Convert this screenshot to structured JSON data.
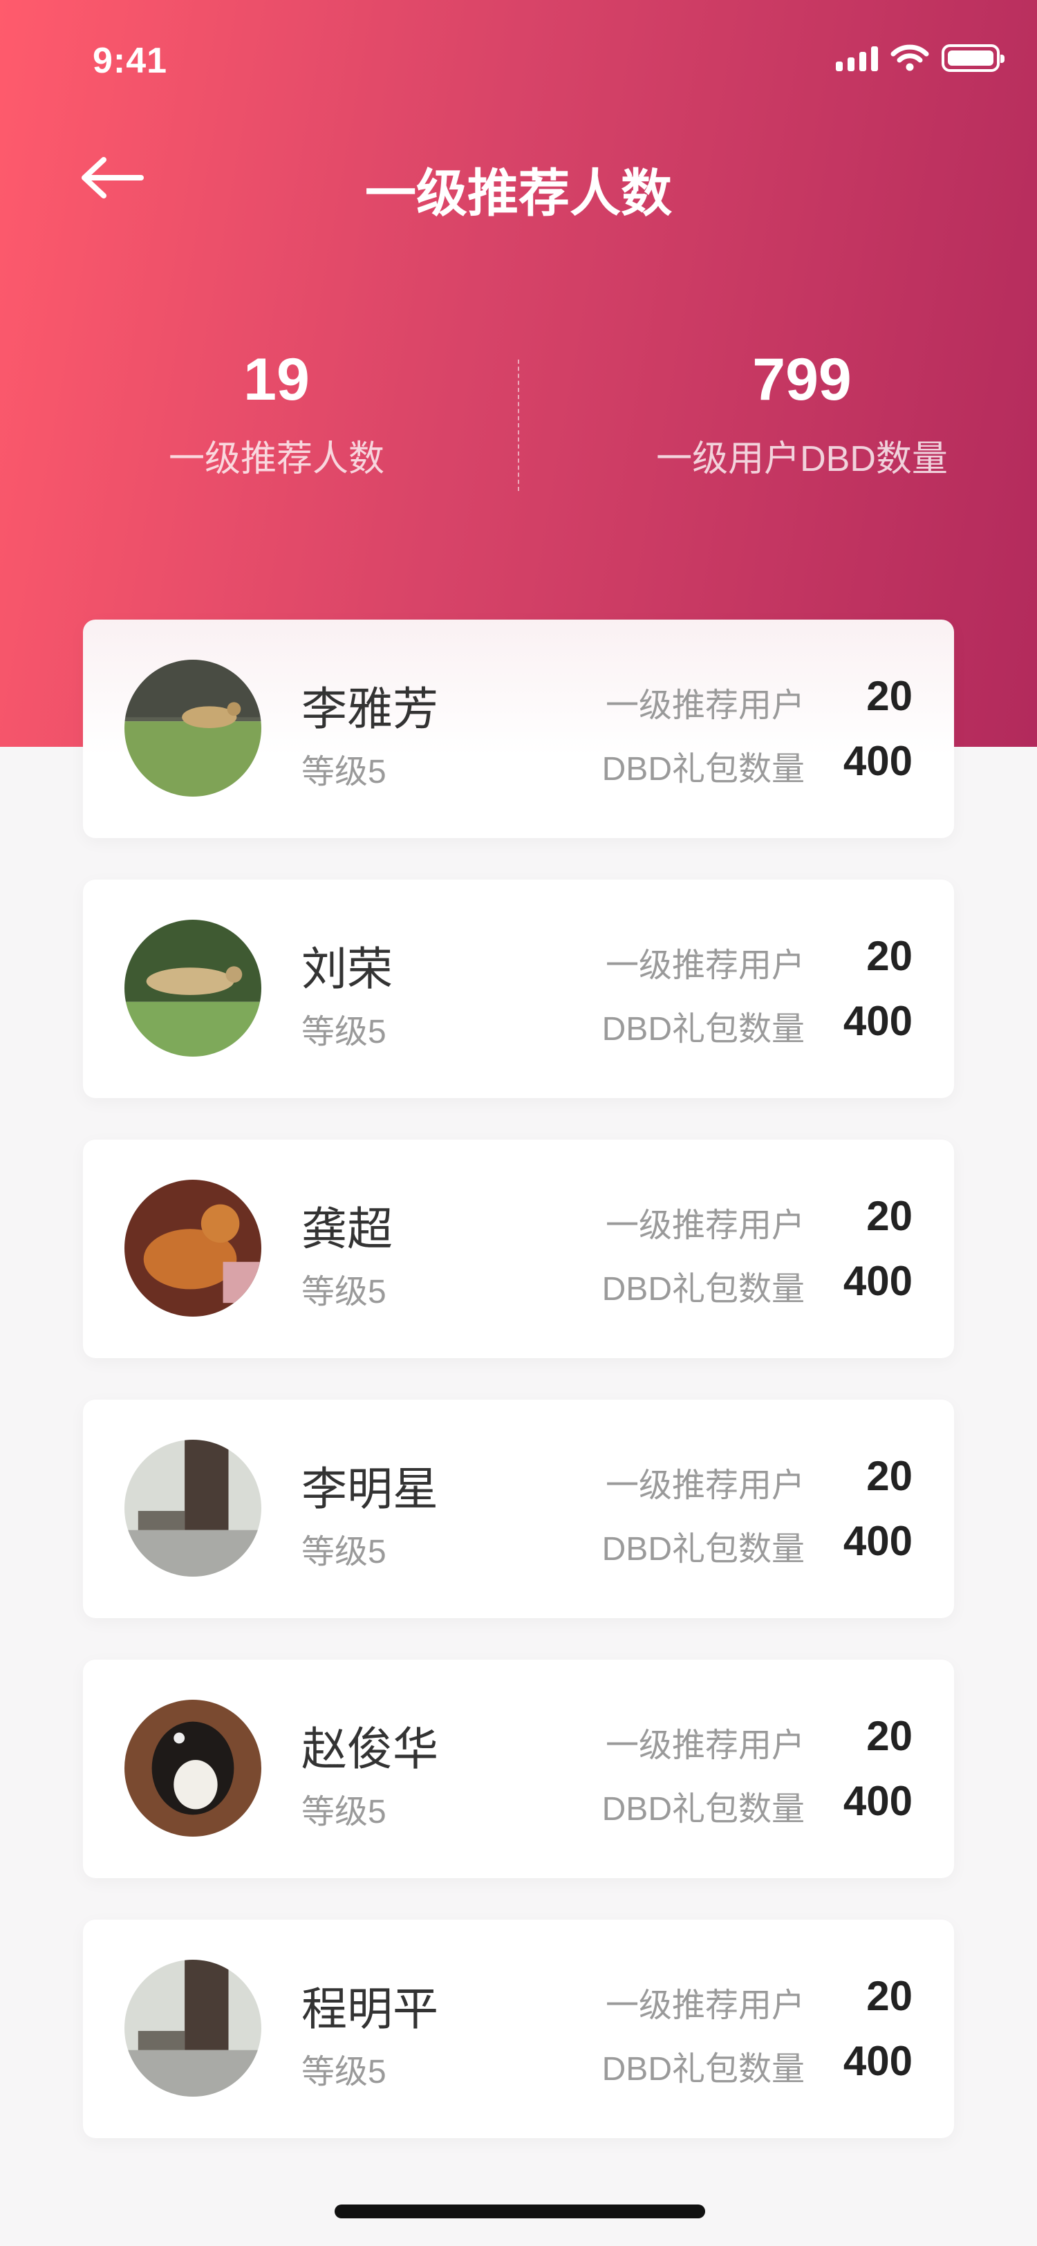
{
  "status_bar": {
    "time": "9:41",
    "icons": [
      "signal-icon",
      "wifi-icon",
      "battery-icon"
    ]
  },
  "nav": {
    "title": "一级推荐人数",
    "back_icon": "arrow-left-icon"
  },
  "summary": {
    "left": {
      "value": "19",
      "label": "一级推荐人数"
    },
    "right": {
      "value": "799",
      "label": "一级用户DBD数量"
    }
  },
  "colors": {
    "header_start": "#ff5b6c",
    "header_end": "#b22a5c",
    "text_dark": "#333333",
    "text_gray": "#9a9a9a"
  },
  "users": [
    {
      "name": "李雅芳",
      "level": "等级5",
      "referrals_label": "一级推荐用户",
      "referrals": "20",
      "packages_label": "DBD礼包数量",
      "packages": "400"
    },
    {
      "name": "刘荣",
      "level": "等级5",
      "referrals_label": "一级推荐用户",
      "referrals": "20",
      "packages_label": "DBD礼包数量",
      "packages": "400"
    },
    {
      "name": "龚超",
      "level": "等级5",
      "referrals_label": "一级推荐用户",
      "referrals": "20",
      "packages_label": "DBD礼包数量",
      "packages": "400"
    },
    {
      "name": "李明星",
      "level": "等级5",
      "referrals_label": "一级推荐用户",
      "referrals": "20",
      "packages_label": "DBD礼包数量",
      "packages": "400"
    },
    {
      "name": "赵俊华",
      "level": "等级5",
      "referrals_label": "一级推荐用户",
      "referrals": "20",
      "packages_label": "DBD礼包数量",
      "packages": "400"
    },
    {
      "name": "程明平",
      "level": "等级5",
      "referrals_label": "一级推荐用户",
      "referrals": "20",
      "packages_label": "DBD礼包数量",
      "packages": "400"
    }
  ]
}
